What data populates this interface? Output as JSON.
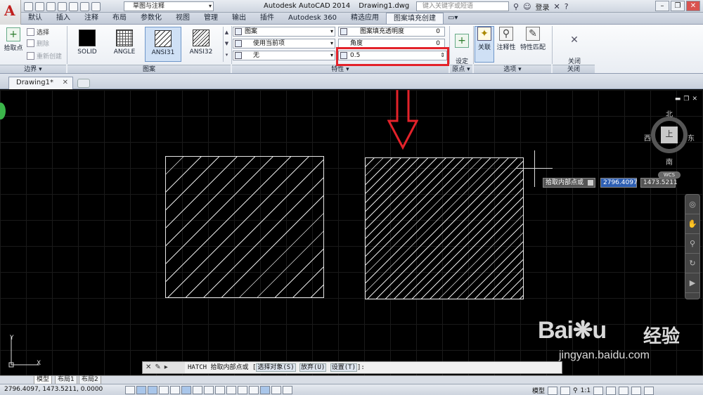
{
  "title_bar": {
    "workspace": "草图与注释",
    "app_title": "Autodesk AutoCAD 2014",
    "file_name": "Drawing1.dwg",
    "search_placeholder": "键入关键字或短语",
    "login": "登录"
  },
  "ribbon_tabs": [
    "默认",
    "插入",
    "注释",
    "布局",
    "参数化",
    "视图",
    "管理",
    "输出",
    "插件",
    "Autodesk 360",
    "精选应用",
    "图案填充创建"
  ],
  "active_tab": "图案填充创建",
  "boundary_panel": {
    "pick_points": "拾取点",
    "select": "选择",
    "remove": "删除",
    "recreate": "重新创建",
    "footer": "边界 ▾"
  },
  "pattern_panel": {
    "patterns": [
      "SOLID",
      "ANGLE",
      "ANSI31",
      "ANSI32"
    ],
    "selected": "ANSI31",
    "footer": "图案"
  },
  "properties_panel": {
    "hatch_type": "图案",
    "color": "使用当前项",
    "background": "无",
    "transparency_label": "图案填充透明度",
    "transparency_value": "0",
    "angle_label": "角度",
    "angle_value": "0",
    "scale_value": "0.5",
    "footer": "特性 ▾"
  },
  "origin_panel": {
    "set_origin": "设定\n原点",
    "footer": "原点 ▾"
  },
  "options_panel": {
    "associative": "关联",
    "annotative": "注释性",
    "match_properties": "特性匹配",
    "footer": "选项 ▾"
  },
  "close_panel": {
    "close_label": "关闭\n图案填充创建",
    "footer": "关闭"
  },
  "doc_tab": "Drawing1*",
  "viewcube": {
    "north": "北",
    "south": "南",
    "east": "东",
    "west": "西",
    "face": "上",
    "wcs": "WCS"
  },
  "tooltip": {
    "prompt": "拾取内部点或",
    "x": "2796.4097",
    "y": "1473.5211"
  },
  "command_line": {
    "command": "HATCH 拾取内部点或 [",
    "opt1": "选择对象(S)",
    "opt2": "放弃(U)",
    "opt3": "设置(T)",
    "end": "]:"
  },
  "ucs": {
    "x": "X",
    "y": "Y"
  },
  "layout_tabs": [
    "模型",
    "布局1",
    "布局2"
  ],
  "status_bar": {
    "coords": "2796.4097, 1473.5211, 0.0000",
    "model": "模型",
    "scale": "1:1"
  },
  "watermark": {
    "logo": "Baidu",
    "cn": "经验",
    "url": "jingyan.baidu.com"
  },
  "colors": {
    "accent_red": "#e3222a",
    "hatch_line": "#e6e6e6",
    "canvas_bg": "#000000"
  }
}
